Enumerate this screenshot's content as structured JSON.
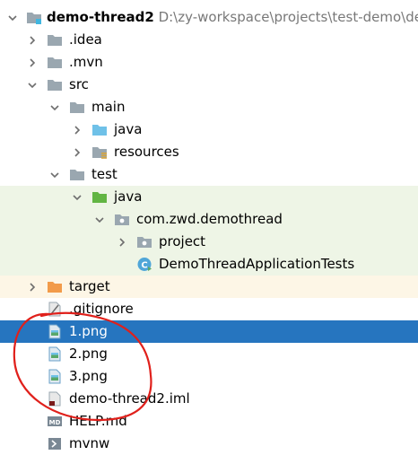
{
  "project_tree": {
    "root": {
      "name": "demo-thread2",
      "path": "D:\\zy-workspace\\projects\\test-demo\\demo"
    },
    "rows": [
      {
        "label": ".idea",
        "depth": 1,
        "toggle": "collapsed",
        "icon": "folder-icon",
        "bg": ""
      },
      {
        "label": ".mvn",
        "depth": 1,
        "toggle": "collapsed",
        "icon": "folder-icon",
        "bg": ""
      },
      {
        "label": "src",
        "depth": 1,
        "toggle": "expanded",
        "icon": "folder-icon",
        "bg": ""
      },
      {
        "label": "main",
        "depth": 2,
        "toggle": "expanded",
        "icon": "folder-icon",
        "bg": ""
      },
      {
        "label": "java",
        "depth": 3,
        "toggle": "collapsed",
        "icon": "source-folder-icon",
        "bg": ""
      },
      {
        "label": "resources",
        "depth": 3,
        "toggle": "collapsed",
        "icon": "resources-folder-icon",
        "bg": ""
      },
      {
        "label": "test",
        "depth": 2,
        "toggle": "expanded",
        "icon": "folder-icon",
        "bg": ""
      },
      {
        "label": "java",
        "depth": 3,
        "toggle": "expanded",
        "icon": "test-folder-icon",
        "bg": "test"
      },
      {
        "label": "com.zwd.demothread",
        "depth": 4,
        "toggle": "expanded",
        "icon": "package-icon",
        "bg": "test"
      },
      {
        "label": "project",
        "depth": 5,
        "toggle": "collapsed",
        "icon": "package-icon",
        "bg": "test"
      },
      {
        "label": "DemoThreadApplicationTests",
        "depth": 5,
        "toggle": "none",
        "icon": "java-class-icon",
        "bg": "test"
      },
      {
        "label": "target",
        "depth": 1,
        "toggle": "collapsed",
        "icon": "excluded-folder-icon",
        "bg": "excluded"
      },
      {
        "label": ".gitignore",
        "depth": 1,
        "toggle": "none",
        "icon": "gitignore-file-icon",
        "bg": ""
      },
      {
        "label": "1.png",
        "depth": 1,
        "toggle": "none",
        "icon": "image-file-icon",
        "bg": "",
        "selected": true
      },
      {
        "label": "2.png",
        "depth": 1,
        "toggle": "none",
        "icon": "image-file-icon",
        "bg": ""
      },
      {
        "label": "3.png",
        "depth": 1,
        "toggle": "none",
        "icon": "image-file-icon",
        "bg": ""
      },
      {
        "label": "demo-thread2.iml",
        "depth": 1,
        "toggle": "none",
        "icon": "iml-file-icon",
        "bg": ""
      },
      {
        "label": "HELP.md",
        "depth": 1,
        "toggle": "none",
        "icon": "markdown-file-icon",
        "bg": ""
      },
      {
        "label": "mvnw",
        "depth": 1,
        "toggle": "none",
        "icon": "script-file-icon",
        "bg": ""
      }
    ]
  },
  "colors": {
    "selection": "#2675bf",
    "test_background": "#eef5e6",
    "excluded_background": "#fdf6e6",
    "annotation_circle": "#e0201b"
  }
}
